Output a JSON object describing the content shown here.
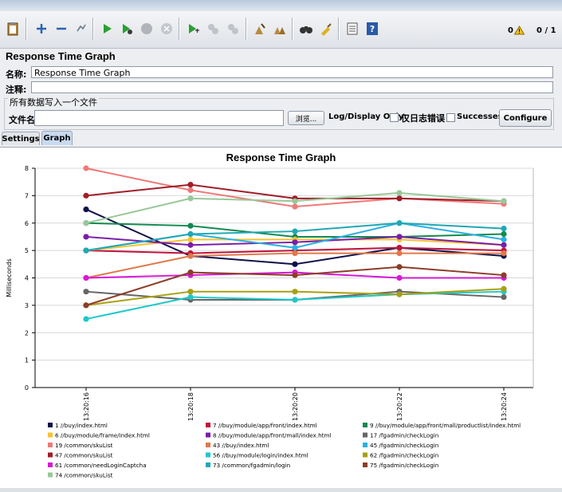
{
  "toolbar": {
    "warning_count": "0",
    "thread_count": "0 / 1"
  },
  "panel": {
    "title": "Response Time Graph",
    "name_label": "名称:",
    "name_value": "Response Time Graph",
    "comment_label": "注释:",
    "comment_value": "",
    "file_group_title": "所有数据写入一个文件",
    "file_label": "文件名",
    "file_value": "",
    "browse_label": "浏览...",
    "log_display_label": "Log/Display Only:",
    "errors_only_label": "仅日志错误",
    "successes_label": "Successes",
    "configure_label": "Configure"
  },
  "tabs": [
    "Settings",
    "Graph"
  ],
  "chart_data": {
    "type": "line",
    "title": "Response Time Graph",
    "ylabel": "Milliseconds",
    "xlabel": "",
    "x": [
      "13:20:16",
      "13:20:18",
      "13:20:20",
      "13:20:22",
      "13:20:24"
    ],
    "ylim": [
      0,
      8
    ],
    "yticks": [
      0,
      1,
      2,
      3,
      4,
      5,
      6,
      7,
      8
    ],
    "grid": true,
    "legend_position": "bottom",
    "series": [
      {
        "name": "1 //buy/index.html",
        "color": "#10104a",
        "values": [
          6.5,
          4.8,
          4.5,
          5.1,
          4.8
        ]
      },
      {
        "name": "7 //buy/module/app/front/index.html",
        "color": "#c0143c",
        "values": [
          5.0,
          4.9,
          5.0,
          5.1,
          5.0
        ]
      },
      {
        "name": "9 //buy/module/app/front/mall/productlist/index.html",
        "color": "#118a50",
        "values": [
          6.0,
          5.9,
          5.5,
          5.5,
          5.6
        ]
      },
      {
        "name": "6 //buy/module/frame/index.html",
        "color": "#f5c232",
        "values": [
          5.0,
          5.4,
          5.4,
          5.4,
          5.2
        ]
      },
      {
        "name": "8 //buy/module/app/front/mall/index.html",
        "color": "#7a1ea8",
        "values": [
          5.5,
          5.2,
          5.3,
          5.5,
          5.2
        ]
      },
      {
        "name": "17 /fgadmin/checkLogin",
        "color": "#666666",
        "values": [
          3.5,
          3.2,
          3.2,
          3.5,
          3.3
        ]
      },
      {
        "name": "19 /common/skuList",
        "color": "#f07878",
        "values": [
          8.0,
          7.2,
          6.6,
          6.9,
          6.7
        ]
      },
      {
        "name": "43 //buy/index.html",
        "color": "#e0784a",
        "values": [
          4.0,
          4.8,
          4.9,
          4.9,
          4.9
        ]
      },
      {
        "name": "45 /fgadmin/checkLogin",
        "color": "#2ab0e0",
        "values": [
          5.0,
          5.6,
          5.1,
          6.0,
          5.4
        ]
      },
      {
        "name": "47 /common/skuList",
        "color": "#a01e28",
        "values": [
          7.0,
          7.4,
          6.9,
          6.9,
          6.8
        ]
      },
      {
        "name": "56 //buy/module/login/index.html",
        "color": "#1ec8c8",
        "values": [
          2.5,
          3.3,
          3.2,
          3.4,
          3.5
        ]
      },
      {
        "name": "62 /fgadmin/checkLogin",
        "color": "#a8a010",
        "values": [
          3.0,
          3.5,
          3.5,
          3.4,
          3.6
        ]
      },
      {
        "name": "61 /common/needLoginCaptcha",
        "color": "#d818d8",
        "values": [
          4.0,
          4.1,
          4.2,
          4.0,
          4.0
        ]
      },
      {
        "name": "73 /common/fgadmin/login",
        "color": "#20a8b4",
        "values": [
          5.0,
          5.6,
          5.7,
          6.0,
          5.8
        ]
      },
      {
        "name": "75 /fgadmin/checkLogin",
        "color": "#8c3c28",
        "values": [
          3.0,
          4.2,
          4.1,
          4.4,
          4.1
        ]
      },
      {
        "name": "74 /common/skuList",
        "color": "#98c898",
        "values": [
          6.0,
          6.9,
          6.8,
          7.1,
          6.8
        ]
      }
    ]
  }
}
